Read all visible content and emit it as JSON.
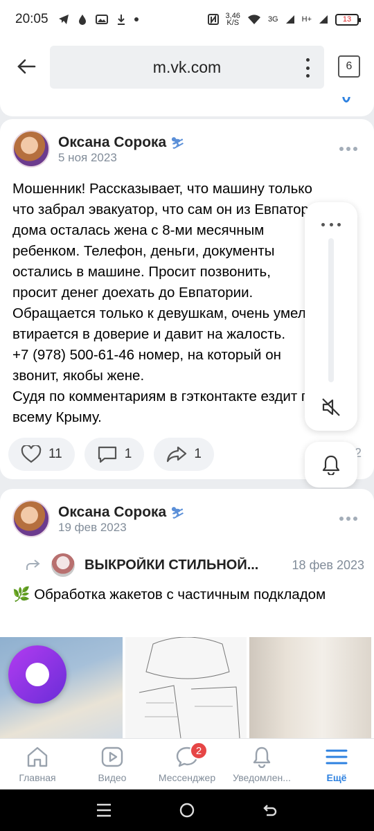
{
  "statusbar": {
    "time": "20:05",
    "net_speed": "3,46",
    "net_unit": "K/S",
    "signal1": "3G",
    "signal2": "H+",
    "battery": "13"
  },
  "browser": {
    "url": "m.vk.com",
    "tabs_count": "6"
  },
  "post1": {
    "author": "Оксана Сорока",
    "date": "5 ноя 2023",
    "text": "Мошенник! Рассказывает, что машину только\nчто забрал эвакуатор, что сам он из Евпатории,\nдома осталась жена с 8-ми месячным\nребенком. Телефон, деньги, документы\nостались в машине. Просит позвонить,\nпросит денег доехать до Евпатории.\nОбращается только к девушкам, очень умело\nвтирается в доверие и давит на жалость.\n+7 (978) 500-61-46 номер, на который он\nзвонит, якобы жене.\nСудя по комментариям в гэтконтакте ездит по\nвсему Крыму.",
    "likes": "11",
    "comments": "1",
    "shares": "1",
    "views": "2"
  },
  "post2": {
    "author": "Оксана Сорока",
    "date": "19 фев 2023",
    "repost_source": "ВЫКРОЙКИ СТИЛЬНОЙ...",
    "repost_date": "18 фев 2023",
    "text": "🌿 Обработка жакетов с частичным подкладом"
  },
  "bottomnav": {
    "items": [
      {
        "label": "Главная"
      },
      {
        "label": "Видео"
      },
      {
        "label": "Мессенджер",
        "badge": "2"
      },
      {
        "label": "Уведомлен..."
      },
      {
        "label": "Ещё"
      }
    ]
  },
  "colors": {
    "accent": "#2d81e0",
    "badge": "#e64646",
    "secondary_text": "#818c99"
  }
}
